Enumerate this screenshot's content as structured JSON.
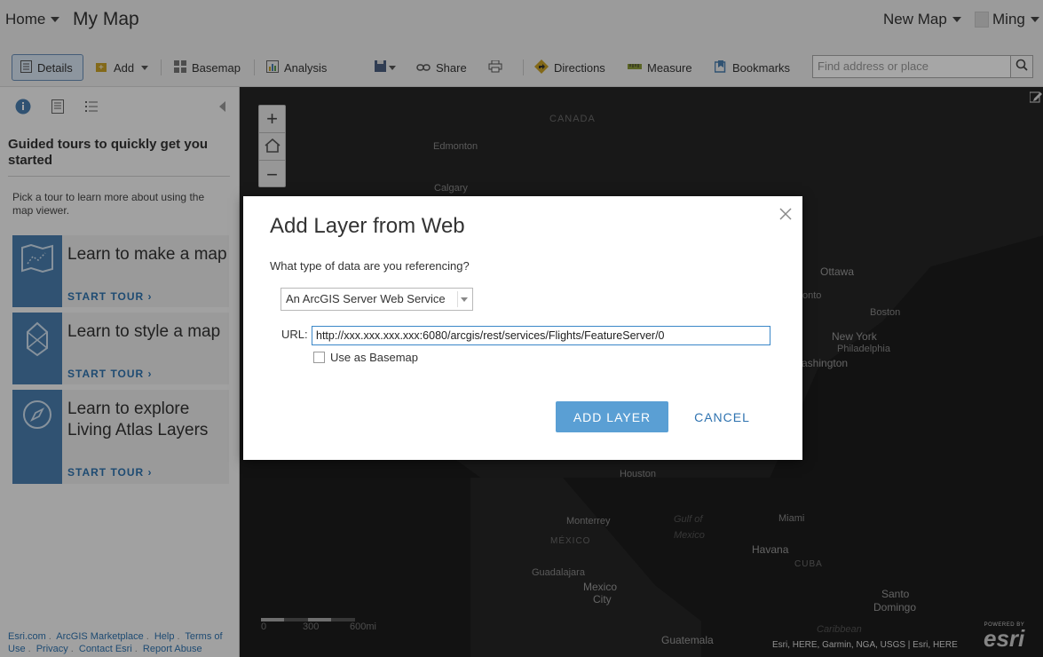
{
  "header": {
    "home": "Home",
    "map_title": "My Map",
    "new_map": "New Map",
    "user": "Ming"
  },
  "toolbar": {
    "details": "Details",
    "add": "Add",
    "basemap": "Basemap",
    "analysis": "Analysis",
    "share": "Share",
    "directions": "Directions",
    "measure": "Measure",
    "bookmarks": "Bookmarks",
    "search_placeholder": "Find address or place"
  },
  "sidebar": {
    "heading": "Guided tours to quickly get you started",
    "intro": "Pick a tour to learn more about using the map viewer.",
    "tours": [
      {
        "title": "Learn to make a map",
        "link": "START TOUR ›"
      },
      {
        "title": "Learn to style a map",
        "link": "START TOUR ›"
      },
      {
        "title": "Learn to explore Living Atlas Layers",
        "link": "START TOUR ›"
      }
    ],
    "footer": {
      "esri": "Esri.com",
      "marketplace": "ArcGIS Marketplace",
      "help": "Help",
      "terms": "Terms of Use",
      "privacy": "Privacy",
      "contact": "Contact Esri",
      "report": "Report Abuse"
    }
  },
  "map": {
    "labels": {
      "canada": "CANADA",
      "edmonton": "Edmonton",
      "calgary": "Calgary",
      "ottawa": "Ottawa",
      "toronto": "onto",
      "boston": "Boston",
      "new_york": "New York",
      "philadelphia": "Philadelphia",
      "washington": "ashington",
      "houston": "Houston",
      "monterrey": "Monterrey",
      "gulf": "Gulf of",
      "mexico_water": "Mexico",
      "mexico_country": "MÉXICO",
      "miami": "Miami",
      "havana": "Havana",
      "cuba": "CUBA",
      "guadalajara": "Guadalajara",
      "mexico_city_1": "Mexico",
      "mexico_city_2": "City",
      "santo": "Santo",
      "domingo": "Domingo",
      "caribbean": "Caribbean",
      "guatemala": "Guatemala"
    },
    "scale": {
      "s0": "0",
      "s1": "300",
      "s2": "600mi"
    },
    "attribution": "Esri, HERE, Garmin, NGA, USGS | Esri, HERE",
    "powered_by": "POWERED BY",
    "esri_logo": "esri"
  },
  "dialog": {
    "title": "Add Layer from Web",
    "question": "What type of data are you referencing?",
    "type_selected": "An ArcGIS Server Web Service",
    "url_label": "URL:",
    "url_value": "http://xxx.xxx.xxx.xxx:6080/arcgis/rest/services/Flights/FeatureServer/0",
    "basemap_label": "Use as Basemap",
    "add_button": "ADD LAYER",
    "cancel_button": "CANCEL"
  }
}
